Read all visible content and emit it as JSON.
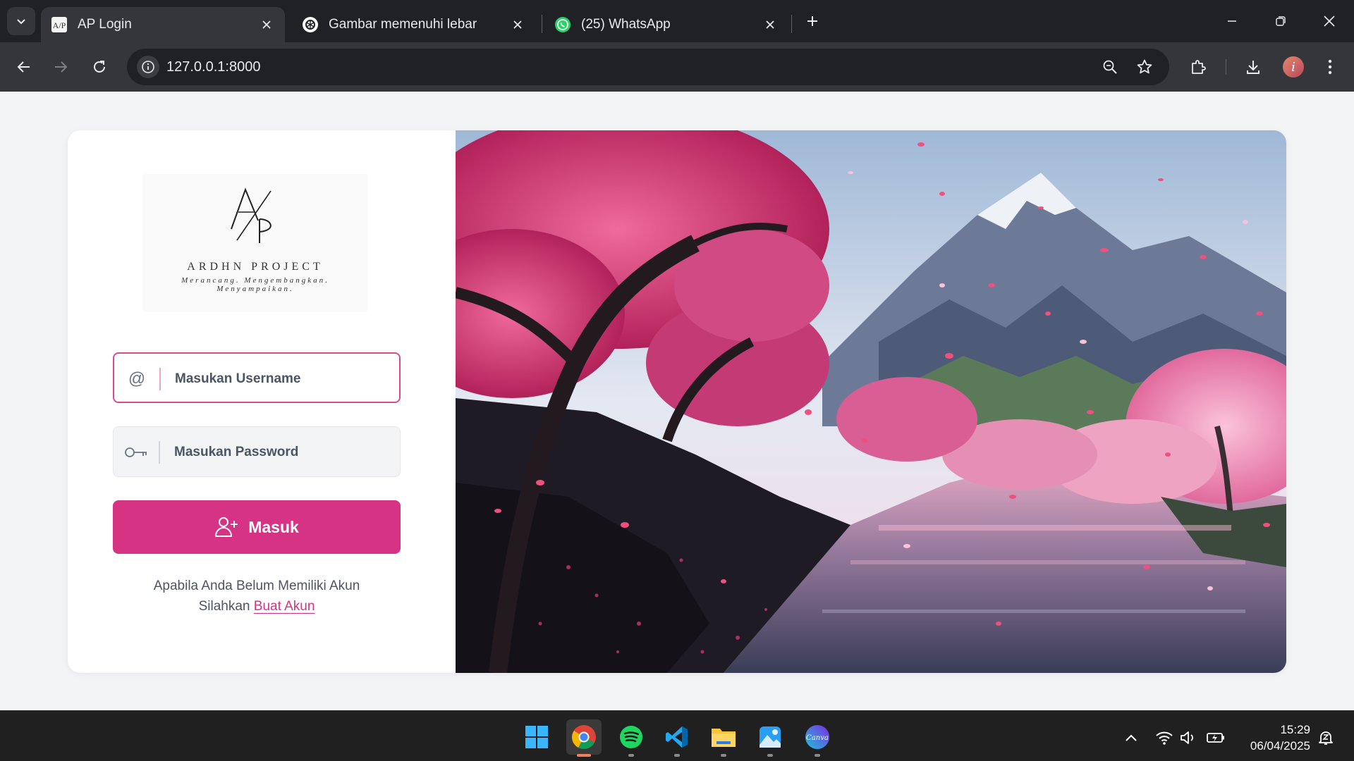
{
  "browser": {
    "tabs": [
      {
        "title": "AP Login",
        "favicon": "ap-logo-icon",
        "active": true
      },
      {
        "title": "Gambar memenuhi lebar",
        "favicon": "chatgpt-icon",
        "active": false
      },
      {
        "title": "(25) WhatsApp",
        "favicon": "whatsapp-icon",
        "active": false
      }
    ],
    "url": "127.0.0.1:8000",
    "profile_initial": "i"
  },
  "login": {
    "logo": {
      "mark": "A/P",
      "name": "ARDHN PROJECT",
      "tagline": "Merancang. Mengembangkan. Menyampaikan."
    },
    "username": {
      "placeholder": "Masukan Username",
      "value": "",
      "icon": "at-icon"
    },
    "password": {
      "placeholder": "Masukan Password",
      "value": "",
      "icon": "key-icon"
    },
    "submit_label": "Masuk",
    "register_prompt": "Apabila Anda Belum Memiliki Akun",
    "register_prefix": "Silahkan",
    "register_link": "Buat Akun"
  },
  "colors": {
    "accent": "#d63384",
    "focus_border": "#db4b8b"
  },
  "taskbar": {
    "apps": [
      "windows-start-icon",
      "chrome-icon",
      "spotify-icon",
      "vscode-icon",
      "file-explorer-icon",
      "photos-icon",
      "canva-icon"
    ],
    "time": "15:29",
    "date": "06/04/2025"
  }
}
